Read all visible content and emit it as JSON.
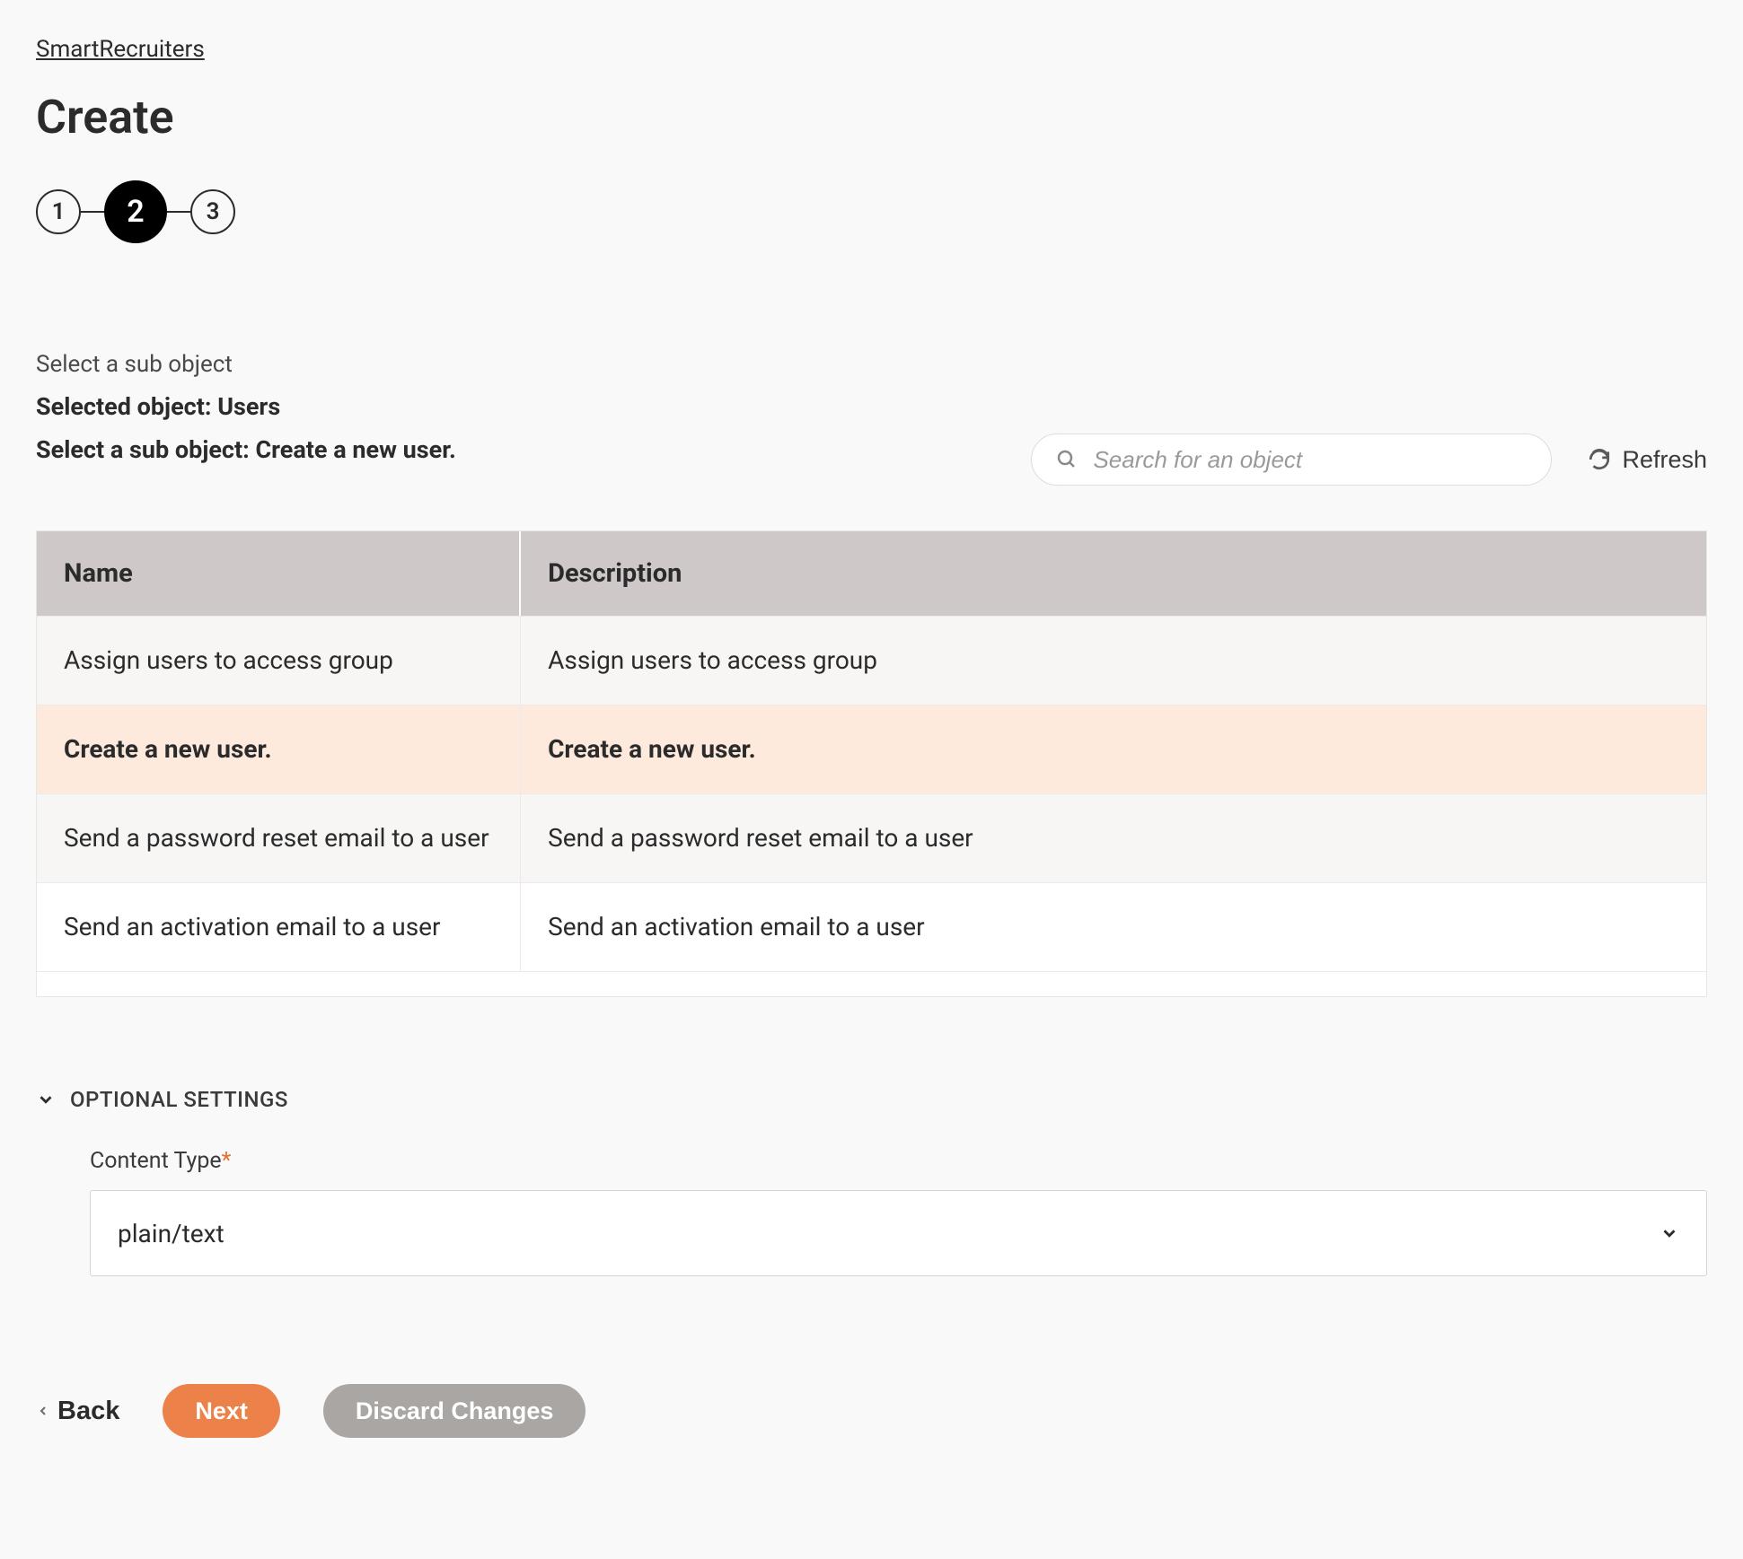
{
  "breadcrumb": "SmartRecruiters",
  "page_title": "Create",
  "stepper": {
    "steps": [
      "1",
      "2",
      "3"
    ],
    "active_index": 1
  },
  "section": {
    "label": "Select a sub object",
    "selected_object_prefix": "Selected object: ",
    "selected_object_value": "Users",
    "sub_object_prefix": "Select a sub object: ",
    "sub_object_value": "Create a new user."
  },
  "search": {
    "placeholder": "Search for an object"
  },
  "refresh_label": "Refresh",
  "table": {
    "headers": {
      "name": "Name",
      "description": "Description"
    },
    "rows": [
      {
        "name": "Assign users to access group",
        "description": "Assign users to access group",
        "selected": false
      },
      {
        "name": "Create a new user.",
        "description": "Create a new user.",
        "selected": true
      },
      {
        "name": "Send a password reset email to a user",
        "description": "Send a password reset email to a user",
        "selected": false
      },
      {
        "name": "Send an activation email to a user",
        "description": "Send an activation email to a user",
        "selected": false
      }
    ]
  },
  "optional": {
    "title": "OPTIONAL SETTINGS",
    "content_type_label": "Content Type",
    "content_type_value": "plain/text"
  },
  "buttons": {
    "back": "Back",
    "next": "Next",
    "discard": "Discard Changes"
  }
}
